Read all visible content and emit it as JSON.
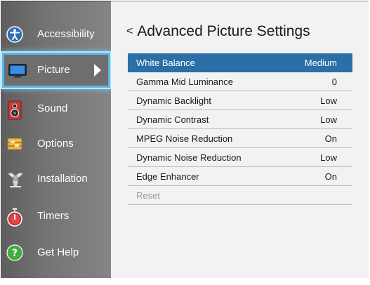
{
  "sidebar": {
    "items": [
      {
        "label": "Accessibility",
        "icon": "accessibility-icon"
      },
      {
        "label": "Picture",
        "icon": "picture-icon"
      },
      {
        "label": "Sound",
        "icon": "speaker-icon"
      },
      {
        "label": "Options",
        "icon": "options-icon"
      },
      {
        "label": "Installation",
        "icon": "satellite-icon"
      },
      {
        "label": "Timers",
        "icon": "timer-icon"
      },
      {
        "label": "Get Help",
        "icon": "help-icon"
      }
    ],
    "selected_index": 1
  },
  "panel": {
    "back_glyph": "<",
    "title": "Advanced Picture Settings",
    "rows": [
      {
        "label": "White Balance",
        "value": "Medium"
      },
      {
        "label": "Gamma Mid Luminance",
        "value": "0"
      },
      {
        "label": "Dynamic Backlight",
        "value": "Low"
      },
      {
        "label": "Dynamic Contrast",
        "value": "Low"
      },
      {
        "label": "MPEG Noise Reduction",
        "value": "On"
      },
      {
        "label": "Dynamic Noise Reduction",
        "value": "Low"
      },
      {
        "label": "Edge Enhancer",
        "value": "On"
      },
      {
        "label": "Reset",
        "value": ""
      }
    ]
  },
  "colors": {
    "selection_blue": "#2a6fa7",
    "focus_outline": "#57b9e8"
  }
}
